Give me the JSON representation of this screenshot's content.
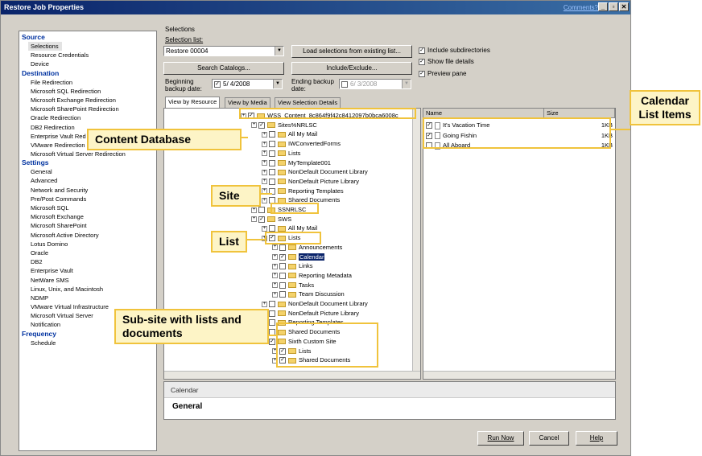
{
  "window": {
    "title": "Restore Job Properties",
    "comments_link": "Comments?",
    "controls": [
      "_",
      "🗗",
      "✕"
    ]
  },
  "nav": {
    "groups": [
      {
        "heading": "Source",
        "items": [
          "Selections",
          "Resource Credentials",
          "Device"
        ]
      },
      {
        "heading": "Destination",
        "items": [
          "File Redirection",
          "Microsoft SQL Redirection",
          "Microsoft Exchange Redirection",
          "Microsoft SharePoint Redirection",
          "Oracle Redirection",
          "DB2 Redirection",
          "Enterprise Vault Red",
          "VMware Redirection",
          "Microsoft Virtual Server Redirection"
        ]
      },
      {
        "heading": "Settings",
        "items": [
          "General",
          "Advanced",
          "Network and Security",
          "Pre/Post Commands",
          "Microsoft SQL",
          "Microsoft Exchange",
          "Microsoft SharePoint",
          "Microsoft Active Directory",
          "Lotus Domino",
          "Oracle",
          "DB2",
          "Enterprise Vault",
          "NetWare SMS",
          "Linux, Unix, and Macintosh",
          "NDMP",
          "VMware Virtual Infrastructure",
          "Microsoft Virtual Server",
          "Notification"
        ]
      },
      {
        "heading": "Frequency",
        "items": [
          "Schedule"
        ]
      }
    ],
    "selected": "Selections"
  },
  "selections": {
    "group_label": "Selections",
    "list_label": "Selection list:",
    "list_value": "Restore 00004",
    "load_button": "Load selections from existing list...",
    "search_button": "Search Catalogs...",
    "include_button": "Include/Exclude...",
    "options": [
      {
        "label": "Include subdirectories",
        "checked": true
      },
      {
        "label": "Show file details",
        "checked": true
      },
      {
        "label": "Preview pane",
        "checked": true
      }
    ],
    "beginning_label": "Beginning backup date:",
    "beginning_value": "5/ 4/2008",
    "ending_label": "Ending backup date:",
    "ending_value": "6/ 3/2008"
  },
  "tabs": [
    "View by Resource",
    "View by Media",
    "View Selection Details"
  ],
  "tree": [
    {
      "label": "WSS_Content_8c864f9f42c8412097b0bca6008c",
      "indent": 0,
      "checked": true
    },
    {
      "label": "Sites%NRLSC",
      "indent": 1,
      "checked": true
    },
    {
      "label": "All My Mail",
      "indent": 2,
      "checked": false
    },
    {
      "label": "IWConvertedForms",
      "indent": 2,
      "checked": false
    },
    {
      "label": "Lists",
      "indent": 2,
      "checked": false
    },
    {
      "label": "MyTemplate001",
      "indent": 2,
      "checked": false
    },
    {
      "label": "NonDefault Document Library",
      "indent": 2,
      "checked": false
    },
    {
      "label": "NonDefault Picture Library",
      "indent": 2,
      "checked": false
    },
    {
      "label": "Reporting Templates",
      "indent": 2,
      "checked": false
    },
    {
      "label": "Shared Documents",
      "indent": 2,
      "checked": false
    },
    {
      "label": "SSNRLSC",
      "indent": 1,
      "checked": false
    },
    {
      "label": "SWS",
      "indent": 1,
      "checked": true
    },
    {
      "label": "All My Mail",
      "indent": 2,
      "checked": false
    },
    {
      "label": "Lists",
      "indent": 2,
      "checked": true
    },
    {
      "label": "Announcements",
      "indent": 3,
      "checked": false
    },
    {
      "label": "Calendar",
      "indent": 3,
      "checked": true,
      "selected": true
    },
    {
      "label": "Links",
      "indent": 3,
      "checked": false
    },
    {
      "label": "Reporting Metadata",
      "indent": 3,
      "checked": false
    },
    {
      "label": "Tasks",
      "indent": 3,
      "checked": false
    },
    {
      "label": "Team Discussion",
      "indent": 3,
      "checked": false
    },
    {
      "label": "NonDefault Document Library",
      "indent": 2,
      "checked": false
    },
    {
      "label": "NonDefault Picture Library",
      "indent": 2,
      "checked": false
    },
    {
      "label": "Reporting Templates",
      "indent": 2,
      "checked": false
    },
    {
      "label": "Shared Documents",
      "indent": 2,
      "checked": false
    },
    {
      "label": "Sixth Custom Site",
      "indent": 2,
      "checked": true
    },
    {
      "label": "Lists",
      "indent": 3,
      "checked": true
    },
    {
      "label": "Shared Documents",
      "indent": 3,
      "checked": true
    }
  ],
  "list": {
    "columns": [
      "Name",
      "Size"
    ],
    "rows": [
      {
        "name": "It's Vacation Time",
        "size": "1KB",
        "checked": true
      },
      {
        "name": "Going Fishin",
        "size": "1KB",
        "checked": true
      },
      {
        "name": "All Aboard",
        "size": "1KB",
        "checked": false
      }
    ]
  },
  "preview": {
    "header": "Calendar",
    "section": "General"
  },
  "footer": {
    "run_now": "Run Now",
    "cancel": "Cancel",
    "help": "Help"
  },
  "callouts": {
    "content_db": "Content Database",
    "site": "Site",
    "list": "List",
    "subsite": "Sub-site with lists and documents",
    "calendar_items": "Calendar List Items"
  }
}
